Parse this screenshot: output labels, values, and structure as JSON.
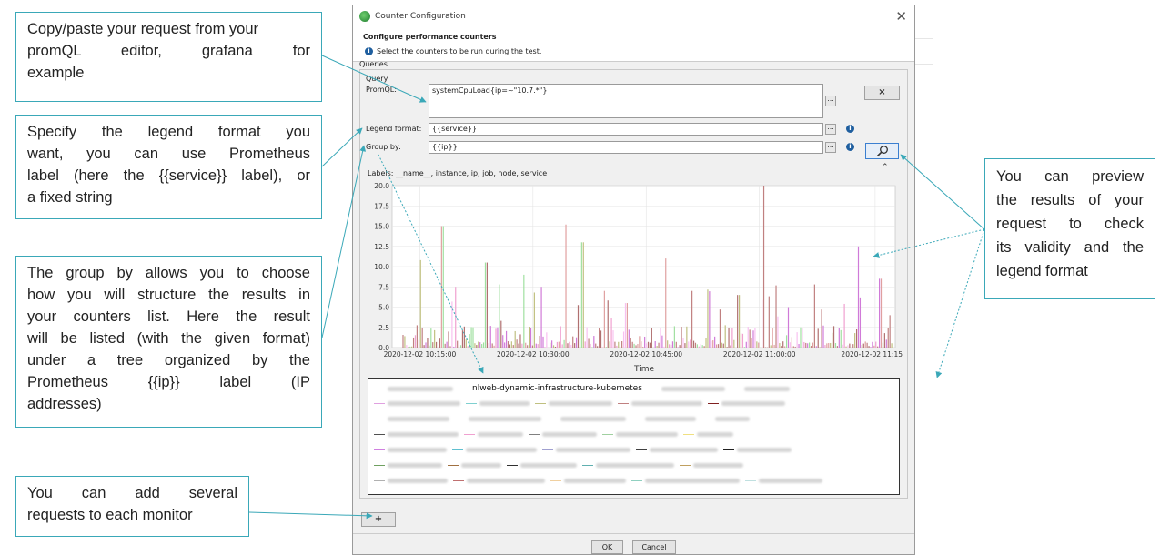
{
  "colors": {
    "accent": "#3aa8b8",
    "dialog_bg": "#f0f0f0"
  },
  "callouts": {
    "copy_paste": [
      "Copy/paste your request from your",
      "promQL editor, grafana for",
      "example"
    ],
    "legend_format": [
      "Specify the legend format you",
      "want, you can use Prometheus",
      "label (here the {{service}} label), or",
      "a fixed string"
    ],
    "group_by": [
      "The group by allows you to choose",
      "how you will structure the results in",
      "your counters list. Here the result",
      "will be listed (with the given format)",
      "under a tree organized by the",
      "Prometheus {{ip}} label (IP",
      "addresses)"
    ],
    "add_requests": [
      "You can add several",
      "requests to each monitor"
    ],
    "preview": [
      "You can preview",
      "the results of your",
      "request to check",
      "its validity and the",
      "legend format"
    ]
  },
  "dialog": {
    "title": "Counter Configuration",
    "header_title": "Configure performance counters",
    "header_subtitle": "Select the counters to be run during the test.",
    "queries_label": "Queries",
    "query_label": "Query",
    "promql_label": "PromQL:",
    "promql_value": "systemCpuLoad{ip=~\"10.7.*\"}",
    "legend_format_label": "Legend format:",
    "legend_format_value": "{{service}}",
    "group_by_label": "Group by:",
    "group_by_value": "{{ip}}",
    "labels_line": "Labels: __name__, instance, ip, job, node, service",
    "delete_button": "×",
    "dots_button": "...",
    "add_button": "+",
    "ok_button": "OK",
    "cancel_button": "Cancel"
  },
  "chart_data": {
    "type": "bar",
    "xlabel": "Time",
    "ylabel": "",
    "ylim": [
      0,
      20
    ],
    "yticks": [
      "0.0",
      "2.5",
      "5.0",
      "7.5",
      "10.0",
      "12.5",
      "15.0",
      "17.5",
      "20.0"
    ],
    "xticks": [
      "2020-12-02 10:15:00",
      "2020-12-02 10:30:00",
      "2020-12-02 10:45:00",
      "2020-12-02 11:00:00",
      "2020-12-02 11:15:0"
    ],
    "grid": true,
    "series_colors": [
      "#d07ad8",
      "#c08080",
      "#f0a0d0",
      "#a0e0a0",
      "#e0a0a0",
      "#b07070",
      "#f8c0f0",
      "#c0c080"
    ]
  },
  "legend": {
    "visible_item": "nlweb-dynamic-infrastructure-kubernetes",
    "rows": [
      {
        "items": [
          {
            "color": "#9a9a9a",
            "w": 72
          },
          {
            "color": "#333333",
            "text": true
          },
          {
            "color": "#7fd0d0",
            "w": 70
          },
          {
            "color": "#c7e07a",
            "w": 50
          }
        ]
      },
      {
        "items": [
          {
            "color": "#e0a0e0",
            "w": 80
          },
          {
            "color": "#7fd0d0",
            "w": 55
          },
          {
            "color": "#c0c080",
            "w": 70
          },
          {
            "color": "#c08080",
            "w": 78
          },
          {
            "color": "#802020",
            "w": 70
          }
        ]
      },
      {
        "items": [
          {
            "color": "#8a4040",
            "w": 68
          },
          {
            "color": "#8fd06f",
            "w": 80
          },
          {
            "color": "#e08080",
            "w": 72
          },
          {
            "color": "#e0e080",
            "w": 56
          },
          {
            "color": "#707070",
            "w": 38
          }
        ]
      },
      {
        "items": [
          {
            "color": "#505050",
            "w": 78
          },
          {
            "color": "#f0a0d0",
            "w": 50
          },
          {
            "color": "#808080",
            "w": 60
          },
          {
            "color": "#a0d0a0",
            "w": 68
          },
          {
            "color": "#f0e080",
            "w": 40
          }
        ]
      },
      {
        "items": [
          {
            "color": "#d080e0",
            "w": 65
          },
          {
            "color": "#60c0d0",
            "w": 78
          },
          {
            "color": "#a0a0d0",
            "w": 82
          },
          {
            "color": "#404040",
            "w": 75
          },
          {
            "color": "#202020",
            "w": 60
          }
        ]
      },
      {
        "items": [
          {
            "color": "#6fa060",
            "w": 60
          },
          {
            "color": "#a07040",
            "w": 44
          },
          {
            "color": "#303030",
            "w": 62
          },
          {
            "color": "#60b0b0",
            "w": 86
          },
          {
            "color": "#c0a060",
            "w": 55
          }
        ]
      },
      {
        "items": [
          {
            "color": "#b0b0b0",
            "w": 66
          },
          {
            "color": "#c07070",
            "w": 86
          },
          {
            "color": "#f0d0a0",
            "w": 68
          },
          {
            "color": "#90d0c0",
            "w": 104
          },
          {
            "color": "#c0e0e0",
            "w": 70
          }
        ]
      }
    ]
  }
}
